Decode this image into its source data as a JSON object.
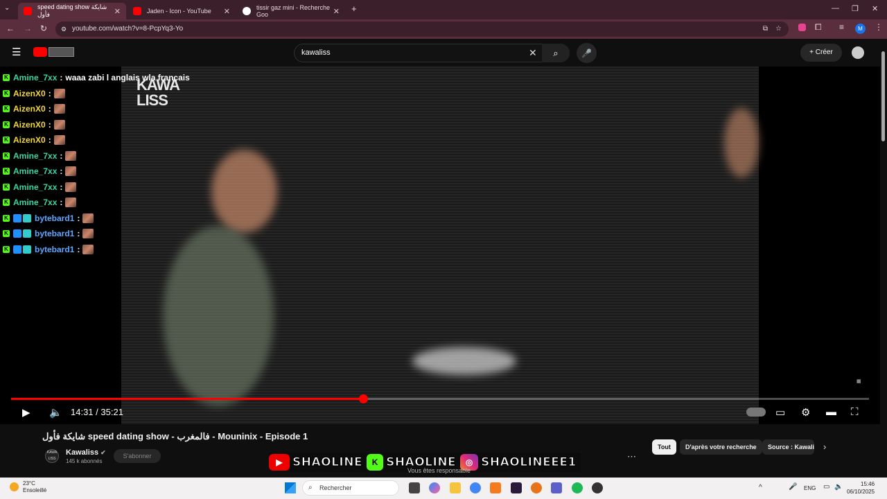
{
  "browser": {
    "tabs": [
      {
        "label": "speed dating show شايكة فأول",
        "active": true,
        "favicon": "youtube-icon"
      },
      {
        "label": "Jaden - Icon - YouTube",
        "active": false,
        "favicon": "youtube-icon"
      },
      {
        "label": "tissir gaz mini - Recherche Goo",
        "active": false,
        "favicon": "google-icon"
      }
    ],
    "url": "youtube.com/watch?v=8-PcpYq3-Yo",
    "profile_initial": "M"
  },
  "youtube": {
    "search_value": "kawaliss",
    "create_label": "Créer"
  },
  "stream_logo": {
    "line1": "KAWA",
    "line2": "LISS"
  },
  "chat": [
    {
      "user": "Amine_7xx",
      "color": "#3bd6a6",
      "text": "waaa zabi l anglais wla français",
      "emote": false,
      "badges": "k"
    },
    {
      "user": "AizenX0",
      "color": "#f5d742",
      "text": "",
      "emote": true,
      "badges": "k"
    },
    {
      "user": "AizenX0",
      "color": "#f5d742",
      "text": "",
      "emote": true,
      "badges": "k"
    },
    {
      "user": "AizenX0",
      "color": "#f5d742",
      "text": "",
      "emote": true,
      "badges": "k"
    },
    {
      "user": "AizenX0",
      "color": "#f5d742",
      "text": "",
      "emote": true,
      "badges": "k"
    },
    {
      "user": "Amine_7xx",
      "color": "#3bd6a6",
      "text": "",
      "emote": true,
      "badges": "k"
    },
    {
      "user": "Amine_7xx",
      "color": "#3bd6a6",
      "text": "",
      "emote": true,
      "badges": "k"
    },
    {
      "user": "Amine_7xx",
      "color": "#3bd6a6",
      "text": "",
      "emote": true,
      "badges": "k"
    },
    {
      "user": "Amine_7xx",
      "color": "#3bd6a6",
      "text": "",
      "emote": true,
      "badges": "k"
    },
    {
      "user": "bytebard1",
      "color": "#5aa8ff",
      "text": "",
      "emote": true,
      "badges": "kss"
    },
    {
      "user": "bytebard1",
      "color": "#5aa8ff",
      "text": "",
      "emote": true,
      "badges": "kss"
    },
    {
      "user": "bytebard1",
      "color": "#5aa8ff",
      "text": "",
      "emote": true,
      "badges": "kss"
    }
  ],
  "player": {
    "current_time": "14:31",
    "duration": "35:21",
    "progress_fraction": 0.41
  },
  "video": {
    "title": "شايكة فأول speed dating show - فالمغرب - Mouninix - Episode 1",
    "channel": "Kawaliss",
    "subscribers": "145 k abonnés",
    "subscribe_label": "S'abonner",
    "channel_icon_text": "KAWA LISS"
  },
  "chips": [
    "Tout",
    "D'après votre recherche",
    "Source : Kawali"
  ],
  "social_overlay": {
    "youtube": "SHAOLINE",
    "kick": "SHAOLINE",
    "instagram": "SHAOLINEEE1",
    "caption": "Vous êtes responsable"
  },
  "taskbar": {
    "temp": "23°C",
    "weather": "Ensoleillé",
    "search_placeholder": "Rechercher",
    "lang": "ENG",
    "time": "15:46",
    "date": "06/10/2025"
  },
  "colors": {
    "accent_red": "#ff0000",
    "kick_green": "#53fc18",
    "tab_bg": "#3b1f2a"
  }
}
